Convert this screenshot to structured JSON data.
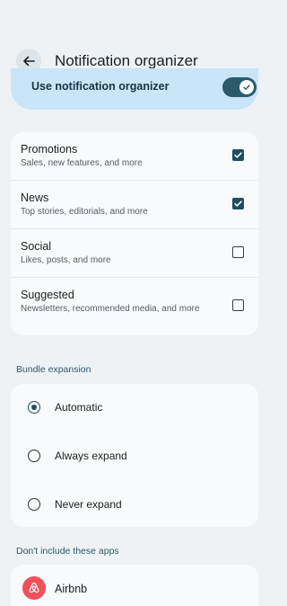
{
  "header": {
    "title": "Notification organizer"
  },
  "master_toggle": {
    "label": "Use notification organizer",
    "enabled": true
  },
  "categories": [
    {
      "title": "Promotions",
      "subtitle": "Sales, new features, and more",
      "checked": true
    },
    {
      "title": "News",
      "subtitle": "Top stories, editorials, and more",
      "checked": true
    },
    {
      "title": "Social",
      "subtitle": "Likes, posts, and more",
      "checked": false
    },
    {
      "title": "Suggested",
      "subtitle": "Newsletters, recommended media, and more",
      "checked": false
    }
  ],
  "bundle": {
    "section_label": "Bundle expansion",
    "options": [
      "Automatic",
      "Always expand",
      "Never expand"
    ],
    "selected": "Automatic"
  },
  "excluded_apps": {
    "section_label": "Don't include these apps",
    "apps": [
      {
        "name": "Airbnb",
        "icon": "airbnb-icon",
        "color": "#f0505a"
      }
    ]
  },
  "colors": {
    "accent": "#1f4e61",
    "toggle_bg": "#c9e5f8",
    "background": "#eef2f5"
  }
}
